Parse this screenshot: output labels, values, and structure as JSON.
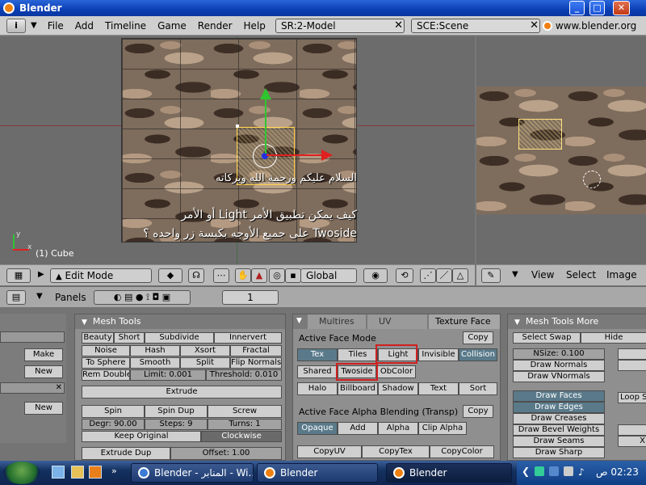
{
  "window": {
    "title": "Blender",
    "min": "_",
    "max": "□",
    "close": "✕"
  },
  "menubar": {
    "items": [
      "File",
      "Add",
      "Timeline",
      "Game",
      "Render",
      "Help"
    ],
    "screen": "SR:2-Model",
    "scene": "SCE:Scene",
    "url": "www.blender.org 2"
  },
  "viewport": {
    "object_label": "(1) Cube",
    "line1": "السلام عليكم ورحمة الله وبركاته",
    "line2": "كيف يمكن تطبيق الأمر Light أو الأمر",
    "line3": "Twoside على جميع الأوجه بكبسة زر واحده ؟",
    "axis_x": "x",
    "axis_y": "y"
  },
  "viewheader": {
    "mode": "Edit Mode",
    "orientation": "Global"
  },
  "imageheader": {
    "menus": [
      "View",
      "Select",
      "Image"
    ]
  },
  "buttonsheader": {
    "panels": "Panels",
    "frame": "1"
  },
  "left_panel": {
    "make": "Make",
    "new1": "New",
    "new2": "New",
    "x": "✕"
  },
  "mesh_tools": {
    "title": "Mesh Tools",
    "beauty": "Beauty",
    "short": "Short",
    "subdivide": "Subdivide",
    "innervert": "Innervert",
    "noise": "Noise",
    "hash": "Hash",
    "xsort": "Xsort",
    "fractal": "Fractal",
    "to_sphere": "To Sphere",
    "smooth": "Smooth",
    "split": "Split",
    "flip_normals": "Flip Normals",
    "rem_double": "Rem Double",
    "limit": "Limit: 0.001",
    "threshold": "Threshold: 0.010",
    "extrude": "Extrude",
    "spin": "Spin",
    "spin_dup": "Spin Dup",
    "screw": "Screw",
    "degr": "Degr: 90.00",
    "steps": "Steps: 9",
    "turns": "Turns: 1",
    "keep_original": "Keep Original",
    "clockwise": "Clockwise",
    "extrude_dup": "Extrude Dup",
    "offset": "Offset: 1.00"
  },
  "tabs": {
    "multires": "Multires",
    "uv": "UV Calculatio",
    "texture_face": "Texture Face"
  },
  "texture_face": {
    "active_face_mode": "Active Face Mode",
    "copy": "Copy",
    "tex": "Tex",
    "tiles": "Tiles",
    "light": "Light",
    "invisible": "Invisible",
    "collision": "Collision",
    "shared": "Shared",
    "twoside": "Twoside",
    "obcolor": "ObColor",
    "halo": "Halo",
    "billboard": "Billboard",
    "shadow": "Shadow",
    "text": "Text",
    "sort": "Sort",
    "alpha_title": "Active Face Alpha Blending (Transp)",
    "copy2": "Copy",
    "opaque": "Opaque",
    "add": "Add",
    "alpha": "Alpha",
    "clip_alpha": "Clip Alpha",
    "copyuv": "CopyUV",
    "copytex": "CopyTex",
    "copycolor": "CopyColor"
  },
  "mesh_more": {
    "title": "Mesh Tools More",
    "select_swap": "Select Swap",
    "hide": "Hide",
    "nsize": "NSize: 0.100",
    "draw_normals": "Draw Normals",
    "draw_vnormals": "Draw VNormals",
    "draw_faces": "Draw Faces",
    "draw_edges": "Draw Edges",
    "draw_creases": "Draw Creases",
    "draw_bevel": "Draw Bevel Weights",
    "draw_seams": "Draw Seams",
    "draw_sharp": "Draw Sharp",
    "loop": "Loop S",
    "x": "X"
  },
  "taskbar": {
    "task1": "Blender - المنابر - Wi...",
    "task2": "Blender",
    "task3": "Blender",
    "clock": "02:23 ص"
  },
  "colors": {
    "accent_red": "#d02020",
    "title_blue": "#0b3fb4"
  }
}
